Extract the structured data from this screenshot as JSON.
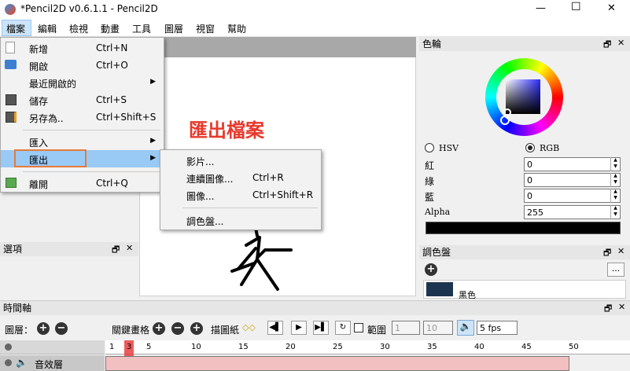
{
  "window": {
    "title": "*Pencil2D v0.6.1.1 - Pencil2D",
    "min": "—",
    "max": "☐",
    "close": "✕"
  },
  "menubar": [
    "檔案",
    "編輯",
    "檢視",
    "動畫",
    "工具",
    "圖層",
    "視窗",
    "幫助"
  ],
  "file_menu": [
    {
      "label": "新增",
      "shortcut": "Ctrl+N"
    },
    {
      "label": "開啟",
      "shortcut": "Ctrl+O"
    },
    {
      "label": "最近開啟的",
      "shortcut": ""
    },
    {
      "label": "儲存",
      "shortcut": "Ctrl+S"
    },
    {
      "label": "另存為..",
      "shortcut": "Ctrl+Shift+S"
    },
    {
      "label": "匯入",
      "shortcut": ""
    },
    {
      "label": "匯出",
      "shortcut": ""
    },
    {
      "label": "離開",
      "shortcut": "Ctrl+Q"
    }
  ],
  "export_submenu": [
    {
      "label": "影片...",
      "shortcut": ""
    },
    {
      "label": "連續圖像...",
      "shortcut": "Ctrl+R"
    },
    {
      "label": "圖像...",
      "shortcut": "Ctrl+Shift+R"
    },
    {
      "label": "調色盤...",
      "shortcut": ""
    }
  ],
  "annotation": "匯出檔案",
  "options_panel": {
    "title": "選項"
  },
  "color_wheel": {
    "title": "色輪",
    "hsv_label": "HSV",
    "rgb_label": "RGB",
    "mode": "RGB",
    "red_label": "紅",
    "red": "0",
    "green_label": "綠",
    "green": "0",
    "blue_label": "藍",
    "blue": "0",
    "alpha_label": "Alpha",
    "alpha": "255",
    "current_color": "#000000"
  },
  "palette": {
    "title": "調色盤",
    "add": "+",
    "more": "...",
    "first_color_name": "黑色",
    "first_color": "#1d3450"
  },
  "timeline": {
    "title": "時間軸",
    "layers_label": "圖層：",
    "keyframe_label": "關鍵畫格",
    "onion_label": "描圖紙",
    "range_label": "範圍",
    "range_start": "1",
    "range_end": "10",
    "fps": "5 fps",
    "sound_layer": "音效層",
    "current_frame": 3,
    "ruler": [
      "1",
      "3",
      "5",
      "10",
      "15",
      "20",
      "25",
      "30",
      "35",
      "40",
      "45",
      "50"
    ]
  },
  "colors": {
    "highlight": "#99c9f5",
    "annotation_red": "#e8392b",
    "marker_red": "#e84040",
    "menu_outline": "#e87a3a"
  }
}
